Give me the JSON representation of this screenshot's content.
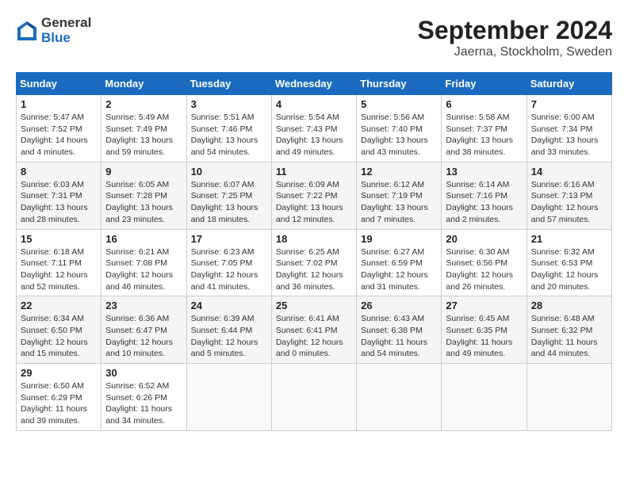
{
  "header": {
    "logo_general": "General",
    "logo_blue": "Blue",
    "month_title": "September 2024",
    "location": "Jaerna, Stockholm, Sweden"
  },
  "weekdays": [
    "Sunday",
    "Monday",
    "Tuesday",
    "Wednesday",
    "Thursday",
    "Friday",
    "Saturday"
  ],
  "days": [
    {
      "date": 1,
      "col": 0,
      "sunrise": "5:47 AM",
      "sunset": "7:52 PM",
      "daylight": "14 hours and 4 minutes."
    },
    {
      "date": 2,
      "col": 1,
      "sunrise": "5:49 AM",
      "sunset": "7:49 PM",
      "daylight": "13 hours and 59 minutes."
    },
    {
      "date": 3,
      "col": 2,
      "sunrise": "5:51 AM",
      "sunset": "7:46 PM",
      "daylight": "13 hours and 54 minutes."
    },
    {
      "date": 4,
      "col": 3,
      "sunrise": "5:54 AM",
      "sunset": "7:43 PM",
      "daylight": "13 hours and 49 minutes."
    },
    {
      "date": 5,
      "col": 4,
      "sunrise": "5:56 AM",
      "sunset": "7:40 PM",
      "daylight": "13 hours and 43 minutes."
    },
    {
      "date": 6,
      "col": 5,
      "sunrise": "5:58 AM",
      "sunset": "7:37 PM",
      "daylight": "13 hours and 38 minutes."
    },
    {
      "date": 7,
      "col": 6,
      "sunrise": "6:00 AM",
      "sunset": "7:34 PM",
      "daylight": "13 hours and 33 minutes."
    },
    {
      "date": 8,
      "col": 0,
      "sunrise": "6:03 AM",
      "sunset": "7:31 PM",
      "daylight": "13 hours and 28 minutes."
    },
    {
      "date": 9,
      "col": 1,
      "sunrise": "6:05 AM",
      "sunset": "7:28 PM",
      "daylight": "13 hours and 23 minutes."
    },
    {
      "date": 10,
      "col": 2,
      "sunrise": "6:07 AM",
      "sunset": "7:25 PM",
      "daylight": "13 hours and 18 minutes."
    },
    {
      "date": 11,
      "col": 3,
      "sunrise": "6:09 AM",
      "sunset": "7:22 PM",
      "daylight": "13 hours and 12 minutes."
    },
    {
      "date": 12,
      "col": 4,
      "sunrise": "6:12 AM",
      "sunset": "7:19 PM",
      "daylight": "13 hours and 7 minutes."
    },
    {
      "date": 13,
      "col": 5,
      "sunrise": "6:14 AM",
      "sunset": "7:16 PM",
      "daylight": "13 hours and 2 minutes."
    },
    {
      "date": 14,
      "col": 6,
      "sunrise": "6:16 AM",
      "sunset": "7:13 PM",
      "daylight": "12 hours and 57 minutes."
    },
    {
      "date": 15,
      "col": 0,
      "sunrise": "6:18 AM",
      "sunset": "7:11 PM",
      "daylight": "12 hours and 52 minutes."
    },
    {
      "date": 16,
      "col": 1,
      "sunrise": "6:21 AM",
      "sunset": "7:08 PM",
      "daylight": "12 hours and 46 minutes."
    },
    {
      "date": 17,
      "col": 2,
      "sunrise": "6:23 AM",
      "sunset": "7:05 PM",
      "daylight": "12 hours and 41 minutes."
    },
    {
      "date": 18,
      "col": 3,
      "sunrise": "6:25 AM",
      "sunset": "7:02 PM",
      "daylight": "12 hours and 36 minutes."
    },
    {
      "date": 19,
      "col": 4,
      "sunrise": "6:27 AM",
      "sunset": "6:59 PM",
      "daylight": "12 hours and 31 minutes."
    },
    {
      "date": 20,
      "col": 5,
      "sunrise": "6:30 AM",
      "sunset": "6:56 PM",
      "daylight": "12 hours and 26 minutes."
    },
    {
      "date": 21,
      "col": 6,
      "sunrise": "6:32 AM",
      "sunset": "6:53 PM",
      "daylight": "12 hours and 20 minutes."
    },
    {
      "date": 22,
      "col": 0,
      "sunrise": "6:34 AM",
      "sunset": "6:50 PM",
      "daylight": "12 hours and 15 minutes."
    },
    {
      "date": 23,
      "col": 1,
      "sunrise": "6:36 AM",
      "sunset": "6:47 PM",
      "daylight": "12 hours and 10 minutes."
    },
    {
      "date": 24,
      "col": 2,
      "sunrise": "6:39 AM",
      "sunset": "6:44 PM",
      "daylight": "12 hours and 5 minutes."
    },
    {
      "date": 25,
      "col": 3,
      "sunrise": "6:41 AM",
      "sunset": "6:41 PM",
      "daylight": "12 hours and 0 minutes."
    },
    {
      "date": 26,
      "col": 4,
      "sunrise": "6:43 AM",
      "sunset": "6:38 PM",
      "daylight": "11 hours and 54 minutes."
    },
    {
      "date": 27,
      "col": 5,
      "sunrise": "6:45 AM",
      "sunset": "6:35 PM",
      "daylight": "11 hours and 49 minutes."
    },
    {
      "date": 28,
      "col": 6,
      "sunrise": "6:48 AM",
      "sunset": "6:32 PM",
      "daylight": "11 hours and 44 minutes."
    },
    {
      "date": 29,
      "col": 0,
      "sunrise": "6:50 AM",
      "sunset": "6:29 PM",
      "daylight": "11 hours and 39 minutes."
    },
    {
      "date": 30,
      "col": 1,
      "sunrise": "6:52 AM",
      "sunset": "6:26 PM",
      "daylight": "11 hours and 34 minutes."
    }
  ]
}
